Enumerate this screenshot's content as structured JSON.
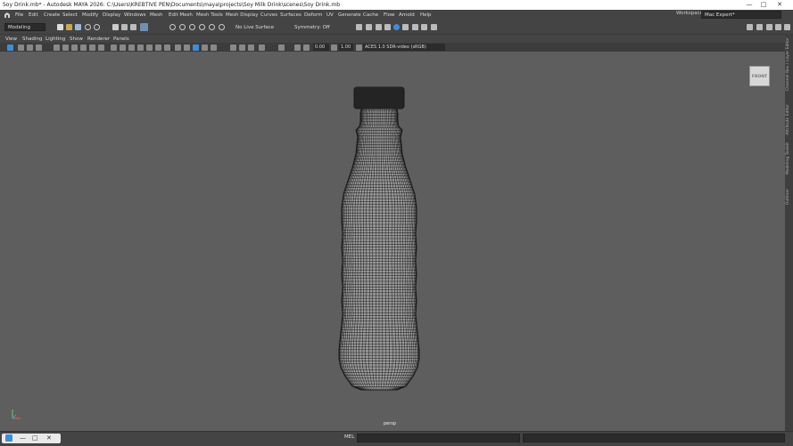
{
  "titlebar": {
    "title": "Soy Drink.mb* - Autodesk MAYA 2026: C:\\Users\\KREBTIVE PEN\\Documents\\maya\\projects\\Soy Milk Drink\\scenes\\Soy Drink.mb",
    "minimize": "—",
    "maximize": "□",
    "close": "✕"
  },
  "menu": {
    "items": [
      "File",
      "Edit",
      "Create",
      "Select",
      "Modify",
      "Display",
      "Windows",
      "Mesh",
      "Edit Mesh",
      "Mesh Tools",
      "Mesh Display",
      "Curves",
      "Surfaces",
      "Deform",
      "UV",
      "Generate",
      "Cache",
      "Flow",
      "Arnold",
      "Help"
    ],
    "workspace_label": "Workspace:",
    "workspace_value": "Mac Expert*"
  },
  "statusline": {
    "mode": "Modeling",
    "live_surface": "No Live Surface",
    "symmetry": "Symmetry: Off"
  },
  "panel_menu": {
    "items": [
      "View",
      "Shading",
      "Lighting",
      "Show",
      "Renderer",
      "Panels"
    ]
  },
  "panel_toolbar": {
    "exposure": "0.00",
    "gamma": "1.00",
    "color_space": "ACES 1.0 SDR-video (sRGB)"
  },
  "viewport": {
    "view_cube": "FRONT",
    "camera": "persp"
  },
  "side_tabs": [
    "Channel Box / Layer Editor",
    "Attribute Editor",
    "Modeling Toolkit",
    "Outliner"
  ],
  "command_line": {
    "label": "MEL"
  },
  "icons": [
    "maya-logo-icon",
    "new-scene-icon",
    "open-scene-icon",
    "save-scene-icon",
    "undo-icon",
    "redo-icon",
    "select-tool-icon",
    "lasso-icon",
    "paint-select-icon",
    "snap-grid-icon",
    "snap-curve-icon",
    "snap-point-icon",
    "render-icon",
    "ipr-render-icon",
    "render-settings-icon",
    "camera-icon",
    "wireframe-icon",
    "smooth-shade-icon",
    "textured-icon",
    "light-icon",
    "shadow-icon",
    "isolate-icon",
    "xray-icon",
    "grid-icon",
    "axis-gizmo-icon",
    "windows-taskbar-icon"
  ],
  "colors": {
    "viewport_bg": "#5e5e5e",
    "panel_bg": "#444444",
    "wireframe": "#1a1a1a",
    "mesh_fill": "#9a9a9a",
    "accent_blue": "#3b8fd8"
  }
}
